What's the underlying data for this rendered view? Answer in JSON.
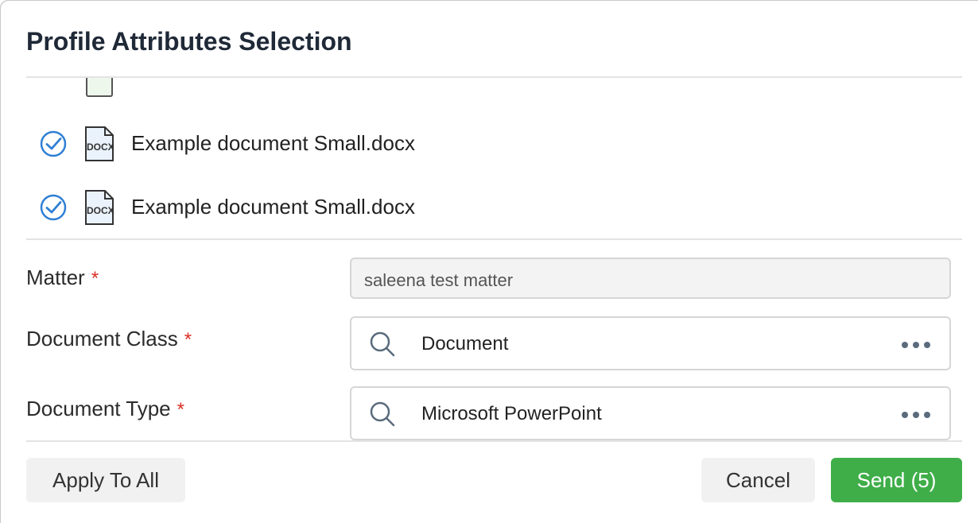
{
  "dialog": {
    "title": "Profile Attributes Selection"
  },
  "files": [
    {
      "name": "Example document Small.docx",
      "icon_text": "DOCX",
      "checked": true
    },
    {
      "name": "Example document Small.docx",
      "icon_text": "DOCX",
      "checked": true
    }
  ],
  "form": {
    "matter": {
      "label": "Matter",
      "required_mark": "*",
      "value": "saleena test matter"
    },
    "document_class": {
      "label": "Document Class",
      "required_mark": "*",
      "value": "Document"
    },
    "document_type": {
      "label": "Document Type",
      "required_mark": "*",
      "value": "Microsoft PowerPoint"
    }
  },
  "buttons": {
    "apply_to_all": "Apply To All",
    "cancel": "Cancel",
    "send": "Send (5)"
  },
  "colors": {
    "accent_blue": "#2f7fd4",
    "send_green": "#3fae49",
    "required_red": "#d93025"
  },
  "icons": [
    "check-circle-icon",
    "docx-file-icon",
    "search-icon",
    "more-dots-icon"
  ]
}
